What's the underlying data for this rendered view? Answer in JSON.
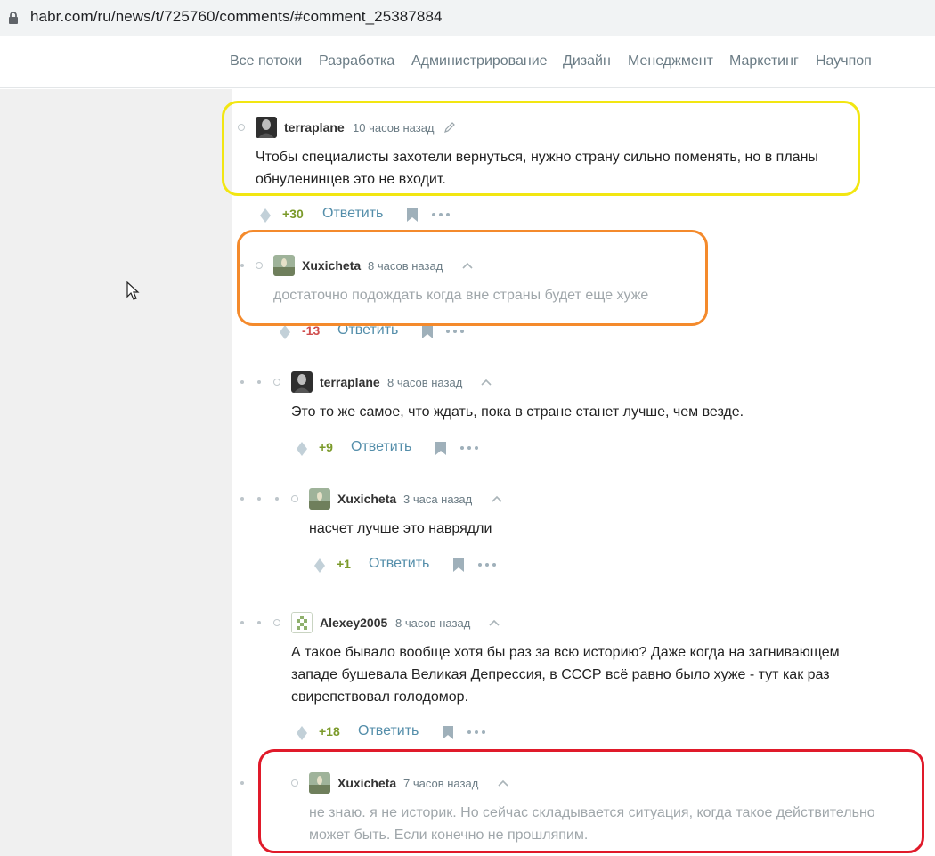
{
  "browser": {
    "url": "habr.com/ru/news/t/725760/comments/#comment_25387884"
  },
  "nav": {
    "items": [
      {
        "label": "Все потоки"
      },
      {
        "label": "Разработка"
      },
      {
        "label": "Администрирование"
      },
      {
        "label": "Дизайн"
      },
      {
        "label": "Менеджмент"
      },
      {
        "label": "Маркетинг"
      },
      {
        "label": "Научпоп"
      }
    ]
  },
  "comments": [
    {
      "author": "terraplane",
      "time": "10 часов назад",
      "text": [
        "Чтобы специалисты захотели вернуться, нужно страну сильно поменять, но в планы",
        "обнуленинцев это не входит."
      ],
      "score": "+30",
      "score_sign": "positive",
      "reply_label": "Ответить",
      "icons": [
        "lock-icon",
        "pencil-icon",
        "vote-icon",
        "bookmark-icon",
        "more-icon"
      ]
    },
    {
      "author": "Xuxicheta",
      "time": "8 часов назад",
      "text": [
        "достаточно подождать когда вне страны будет еще хуже"
      ],
      "score": "-13",
      "score_sign": "negative",
      "reply_label": "Ответить"
    },
    {
      "author": "terraplane",
      "time": "8 часов назад",
      "text": [
        "Это то же самое, что ждать, пока в стране станет лучше, чем везде."
      ],
      "score": "+9",
      "score_sign": "positive",
      "reply_label": "Ответить"
    },
    {
      "author": "Xuxicheta",
      "time": "3 часа назад",
      "text": [
        "насчет лучше это наврядли"
      ],
      "score": "+1",
      "score_sign": "positive",
      "reply_label": "Ответить"
    },
    {
      "author": "Alexey2005",
      "time": "8 часов назад",
      "text": [
        "А такое бывало вообще хотя бы раз за всю историю? Даже когда на загнивающем",
        "западе бушевала Великая Депрессия, в СССР всё равно было хуже - тут как раз",
        "свирепствовал голодомор."
      ],
      "score": "+18",
      "score_sign": "positive",
      "reply_label": "Ответить"
    },
    {
      "author": "Xuxicheta",
      "time": "7 часов назад",
      "text": [
        "не знаю. я не историк. Но сейчас складывается ситуация, когда такое действительно",
        "может быть. Если конечно не прошляпим."
      ]
    }
  ],
  "colors": {
    "highlight_yellow": "#f2e612",
    "highlight_orange": "#f48a2c",
    "highlight_red": "#e01a2a",
    "score_positive": "#7b9a2a",
    "score_negative": "#d04e4e",
    "link": "#548eaa"
  }
}
